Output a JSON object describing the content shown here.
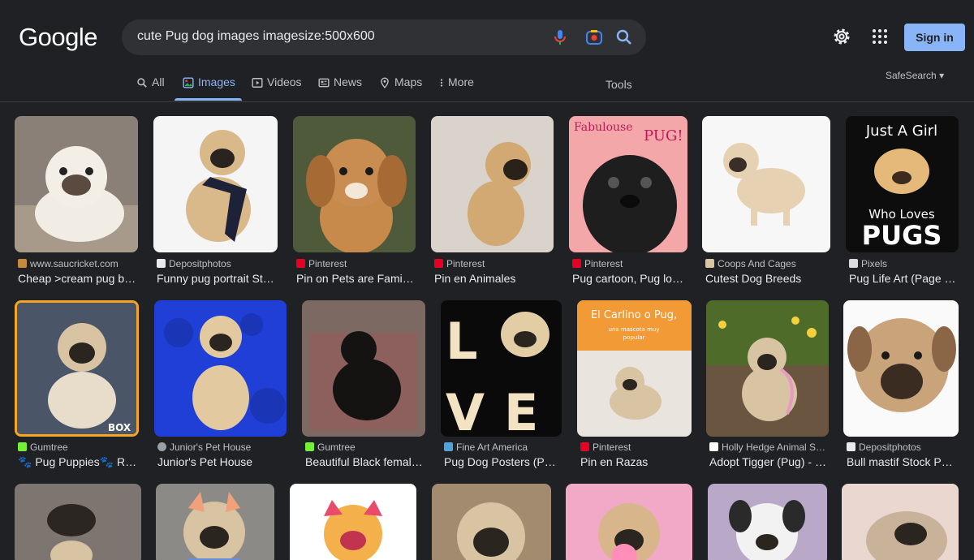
{
  "header": {
    "logo": "Google",
    "search_value": "cute Pug dog images imagesize:500x600",
    "signin_label": "Sign in"
  },
  "tabs": [
    {
      "label": "All"
    },
    {
      "label": "Images"
    },
    {
      "label": "Videos"
    },
    {
      "label": "News"
    },
    {
      "label": "Maps"
    },
    {
      "label": "More"
    }
  ],
  "tools_label": "Tools",
  "safesearch_label": "SafeSearch",
  "results": [
    {
      "source": "www.saucricket.com",
      "title": "Cheap >cream pug bi…",
      "fav": "#c58a3b"
    },
    {
      "source": "Depositphotos",
      "title": "Funny pug portrait Sto…",
      "fav": "#e8eaed"
    },
    {
      "source": "Pinterest",
      "title": "Pin on Pets are Family…",
      "fav": "#e60023"
    },
    {
      "source": "Pinterest",
      "title": "Pin en Animales",
      "fav": "#e60023"
    },
    {
      "source": "Pinterest",
      "title": "Pug cartoon, Pug lov…",
      "fav": "#e60023"
    },
    {
      "source": "Coops And Cages",
      "title": "Cutest Dog Breeds",
      "fav": "#d9c7a0"
    },
    {
      "source": "Pixels",
      "title": "Pug Life Art (Page #…",
      "fav": "#dadce0"
    },
    {
      "source": "Gumtree",
      "title": "🐾 Pug Puppies🐾 RE…",
      "fav": "#72ef36"
    },
    {
      "source": "Junior's Pet House",
      "title": "Junior's Pet House",
      "fav": "#9aa0a6"
    },
    {
      "source": "Gumtree",
      "title": "Beautiful Black female…",
      "fav": "#72ef36"
    },
    {
      "source": "Fine Art America",
      "title": "Pug Dog Posters (Pag…",
      "fav": "#4fa3d9"
    },
    {
      "source": "Pinterest",
      "title": "Pin en Razas",
      "fav": "#e60023"
    },
    {
      "source": "Holly Hedge Animal S…",
      "title": "Adopt Tigger (Pug) - H…",
      "fav": "#ffffff"
    },
    {
      "source": "Depositphotos",
      "title": "Bull mastif Stock Ph…",
      "fav": "#e8eaed"
    }
  ]
}
